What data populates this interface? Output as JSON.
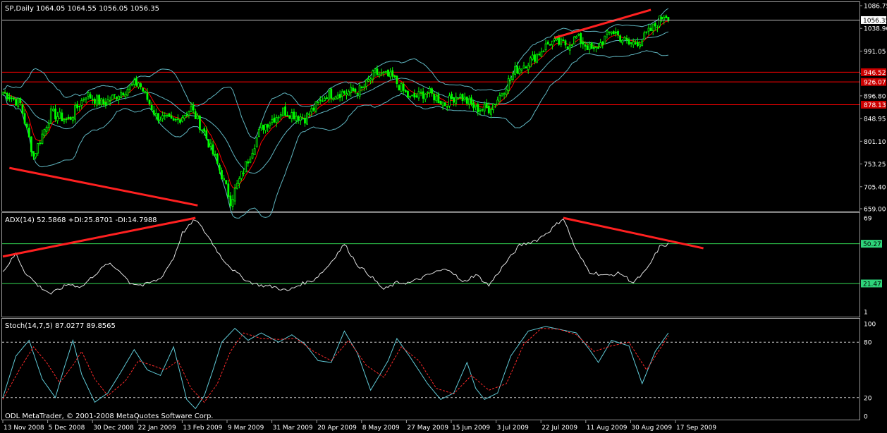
{
  "window": {
    "symbol_header": "SP,Daily  1064.05 1064.55 1056.05 1056.35",
    "footer": "ODL MetaTrader, © 2001-2008 MetaQuotes Software Corp."
  },
  "colors": {
    "background": "#000000",
    "grid": "#9a9a9a",
    "bull_candle": "#00ff00",
    "bear_candle": "#00ff00",
    "bollinger": "#5fb5c0",
    "moving_average": "#ff0000",
    "resistance_line": "#ff0000",
    "trend_line": "#ff2020",
    "adx_line": "#e0e0e0",
    "level_line": "#33dd55",
    "stoch_main": "#5fc9d6",
    "stoch_signal": "#ff2a2a",
    "price_marker": "#e0e0e0",
    "level_badge_red": "#cc0000",
    "level_badge_green": "#2ed47a"
  },
  "x_axis": {
    "labels": [
      "13 Nov 2008",
      "5 Dec 2008",
      "30 Dec 2008",
      "22 Jan 2009",
      "13 Feb 2009",
      "9 Mar 2009",
      "31 Mar 2009",
      "20 Apr 2009",
      "8 May 2009",
      "27 May 2009",
      "15 Jun 2009",
      "3 Jul 2009",
      "22 Jul 2009",
      "11 Aug 2009",
      "30 Aug 2009",
      "17 Sep 2009"
    ]
  },
  "chart_data": [
    {
      "type": "candlestick",
      "title": "SP,Daily",
      "ohlc_last": {
        "open": 1064.05,
        "high": 1064.55,
        "low": 1056.05,
        "close": 1056.35
      },
      "ylim": [
        659.0,
        1086.75
      ],
      "y_ticks": [
        "1086.75",
        "1038.90",
        "991.05",
        "943.20",
        "896.80",
        "848.95",
        "801.10",
        "753.25",
        "705.40",
        "659.00"
      ],
      "current_price": "1056.35",
      "horizontal_levels": [
        {
          "value": 946.52,
          "label": "946.52"
        },
        {
          "value": 926.07,
          "label": "926.07"
        },
        {
          "value": 878.13,
          "label": "878.13"
        }
      ],
      "closes_knots": [
        [
          0,
          905
        ],
        [
          8,
          880
        ],
        [
          14,
          770
        ],
        [
          22,
          860
        ],
        [
          30,
          845
        ],
        [
          38,
          900
        ],
        [
          46,
          880
        ],
        [
          54,
          905
        ],
        [
          62,
          925
        ],
        [
          70,
          855
        ],
        [
          78,
          840
        ],
        [
          86,
          870
        ],
        [
          92,
          820
        ],
        [
          100,
          730
        ],
        [
          104,
          676
        ],
        [
          110,
          740
        ],
        [
          118,
          830
        ],
        [
          128,
          865
        ],
        [
          138,
          850
        ],
        [
          148,
          900
        ],
        [
          158,
          905
        ],
        [
          164,
          910
        ],
        [
          170,
          945
        ],
        [
          178,
          935
        ],
        [
          186,
          890
        ],
        [
          194,
          905
        ],
        [
          202,
          880
        ],
        [
          208,
          900
        ],
        [
          216,
          870
        ],
        [
          222,
          870
        ],
        [
          226,
          890
        ],
        [
          234,
          950
        ],
        [
          242,
          975
        ],
        [
          250,
          1010
        ],
        [
          258,
          1005
        ],
        [
          262,
          1020
        ],
        [
          270,
          990
        ],
        [
          278,
          1035
        ],
        [
          286,
          1005
        ],
        [
          292,
          1015
        ],
        [
          298,
          1045
        ],
        [
          302,
          1068
        ],
        [
          304,
          1065
        ]
      ],
      "trendlines": [
        {
          "from": [
            3,
            745
          ],
          "to": [
            89,
            666
          ]
        },
        {
          "from": [
            252,
            1019
          ],
          "to": [
            296,
            1078
          ]
        }
      ]
    },
    {
      "type": "line",
      "title": "ADX(14) 52.5868 +DI:25.8701 -DI:14.7988",
      "ylim": [
        1,
        69
      ],
      "y_ticks": [
        "69",
        "1"
      ],
      "levels": [
        {
          "value": 50.27,
          "label": "50.27"
        },
        {
          "value": 21.47,
          "label": "21.47"
        }
      ],
      "series_knots": [
        [
          0,
          30
        ],
        [
          6,
          43
        ],
        [
          10,
          30
        ],
        [
          16,
          20
        ],
        [
          22,
          14
        ],
        [
          30,
          21
        ],
        [
          36,
          19
        ],
        [
          42,
          28
        ],
        [
          48,
          36
        ],
        [
          54,
          30
        ],
        [
          58,
          22
        ],
        [
          64,
          20
        ],
        [
          72,
          25
        ],
        [
          78,
          40
        ],
        [
          82,
          58
        ],
        [
          88,
          68
        ],
        [
          94,
          55
        ],
        [
          100,
          40
        ],
        [
          106,
          30
        ],
        [
          112,
          23
        ],
        [
          118,
          20
        ],
        [
          124,
          19
        ],
        [
          130,
          16
        ],
        [
          136,
          21
        ],
        [
          142,
          24
        ],
        [
          148,
          33
        ],
        [
          156,
          50
        ],
        [
          162,
          35
        ],
        [
          168,
          27
        ],
        [
          174,
          17
        ],
        [
          180,
          22
        ],
        [
          186,
          22
        ],
        [
          192,
          26
        ],
        [
          198,
          30
        ],
        [
          204,
          32
        ],
        [
          210,
          22
        ],
        [
          216,
          28
        ],
        [
          222,
          20
        ],
        [
          228,
          33
        ],
        [
          236,
          49
        ],
        [
          244,
          53
        ],
        [
          250,
          60
        ],
        [
          256,
          69
        ],
        [
          262,
          45
        ],
        [
          268,
          30
        ],
        [
          276,
          27
        ],
        [
          282,
          29
        ],
        [
          288,
          22
        ],
        [
          294,
          31
        ],
        [
          300,
          48
        ],
        [
          304,
          50
        ]
      ],
      "trendlines": [
        {
          "from": [
            0,
            41
          ],
          "to": [
            88,
            69
          ]
        },
        {
          "from": [
            256,
            69
          ],
          "to": [
            320,
            47
          ]
        }
      ]
    },
    {
      "type": "line",
      "title": "Stoch(14,7,5) 87.0277 89.8565",
      "ylim": [
        0,
        100
      ],
      "y_ticks": [
        "100",
        "80",
        "20",
        "0"
      ],
      "levels": [
        {
          "value": 80
        },
        {
          "value": 20
        }
      ],
      "series": [
        {
          "name": "main",
          "knots": [
            [
              0,
              20
            ],
            [
              6,
              65
            ],
            [
              12,
              82
            ],
            [
              18,
              40
            ],
            [
              24,
              20
            ],
            [
              28,
              52
            ],
            [
              32,
              82
            ],
            [
              36,
              45
            ],
            [
              42,
              15
            ],
            [
              48,
              25
            ],
            [
              54,
              48
            ],
            [
              60,
              72
            ],
            [
              66,
              50
            ],
            [
              72,
              44
            ],
            [
              78,
              75
            ],
            [
              84,
              18
            ],
            [
              88,
              8
            ],
            [
              92,
              22
            ],
            [
              96,
              50
            ],
            [
              100,
              80
            ],
            [
              106,
              95
            ],
            [
              112,
              82
            ],
            [
              118,
              90
            ],
            [
              126,
              80
            ],
            [
              132,
              88
            ],
            [
              138,
              78
            ],
            [
              144,
              60
            ],
            [
              150,
              58
            ],
            [
              156,
              92
            ],
            [
              162,
              68
            ],
            [
              168,
              28
            ],
            [
              176,
              60
            ],
            [
              180,
              84
            ],
            [
              186,
              64
            ],
            [
              194,
              35
            ],
            [
              200,
              18
            ],
            [
              206,
              25
            ],
            [
              212,
              58
            ],
            [
              216,
              30
            ],
            [
              220,
              18
            ],
            [
              226,
              25
            ],
            [
              232,
              65
            ],
            [
              240,
              92
            ],
            [
              248,
              97
            ],
            [
              256,
              93
            ],
            [
              262,
              90
            ],
            [
              268,
              72
            ],
            [
              272,
              58
            ],
            [
              278,
              82
            ],
            [
              286,
              76
            ],
            [
              292,
              35
            ],
            [
              298,
              70
            ],
            [
              304,
              90
            ]
          ]
        },
        {
          "name": "signal",
          "knots": [
            [
              0,
              18
            ],
            [
              8,
              52
            ],
            [
              14,
              75
            ],
            [
              20,
              58
            ],
            [
              26,
              36
            ],
            [
              32,
              55
            ],
            [
              36,
              70
            ],
            [
              42,
              40
            ],
            [
              48,
              22
            ],
            [
              56,
              38
            ],
            [
              62,
              60
            ],
            [
              68,
              55
            ],
            [
              74,
              50
            ],
            [
              80,
              60
            ],
            [
              86,
              30
            ],
            [
              92,
              15
            ],
            [
              98,
              35
            ],
            [
              104,
              70
            ],
            [
              110,
              90
            ],
            [
              118,
              84
            ],
            [
              126,
              83
            ],
            [
              134,
              84
            ],
            [
              142,
              70
            ],
            [
              150,
              60
            ],
            [
              158,
              82
            ],
            [
              166,
              55
            ],
            [
              174,
              42
            ],
            [
              182,
              75
            ],
            [
              190,
              60
            ],
            [
              198,
              30
            ],
            [
              206,
              24
            ],
            [
              214,
              44
            ],
            [
              222,
              28
            ],
            [
              230,
              35
            ],
            [
              238,
              78
            ],
            [
              246,
              95
            ],
            [
              254,
              94
            ],
            [
              262,
              88
            ],
            [
              270,
              70
            ],
            [
              278,
              76
            ],
            [
              286,
              80
            ],
            [
              294,
              50
            ],
            [
              300,
              72
            ],
            [
              304,
              87
            ]
          ]
        }
      ]
    }
  ]
}
